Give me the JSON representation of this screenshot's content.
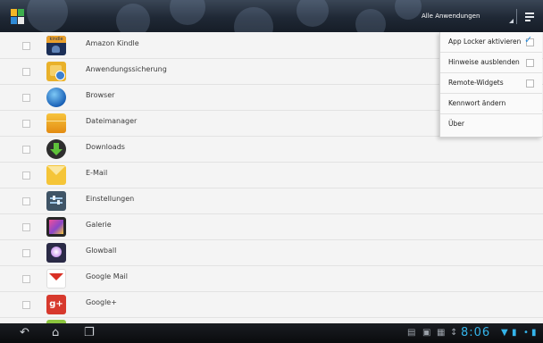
{
  "header": {
    "filter_label": "Alle Anwendungen"
  },
  "apps": [
    {
      "label": "Amazon Kindle",
      "icon": "kindle-icon",
      "icon_text": "kindle",
      "checked": false
    },
    {
      "label": "Anwendungssicherung",
      "icon": "app-backup-icon",
      "checked": false
    },
    {
      "label": "Browser",
      "icon": "browser-globe-icon",
      "checked": false
    },
    {
      "label": "Dateimanager",
      "icon": "folder-icon",
      "checked": false
    },
    {
      "label": "Downloads",
      "icon": "download-icon",
      "checked": false
    },
    {
      "label": "E-Mail",
      "icon": "email-icon",
      "checked": false
    },
    {
      "label": "Einstellungen",
      "icon": "settings-icon",
      "checked": false
    },
    {
      "label": "Galerie",
      "icon": "gallery-icon",
      "checked": false
    },
    {
      "label": "Glowball",
      "icon": "glowball-icon",
      "checked": false
    },
    {
      "label": "Google Mail",
      "icon": "gmail-icon",
      "checked": false
    },
    {
      "label": "Google+",
      "icon": "google-plus-icon",
      "icon_text": "g+",
      "checked": false
    }
  ],
  "menu": {
    "items": [
      {
        "label": "App Locker aktivieren",
        "checkbox": true,
        "checked": true
      },
      {
        "label": "Hinweise ausblenden",
        "checkbox": true,
        "checked": false
      },
      {
        "label": "Remote-Widgets",
        "checkbox": true,
        "checked": false
      },
      {
        "label": "Kennwort ändern",
        "checkbox": false
      },
      {
        "label": "Über",
        "checkbox": false
      }
    ]
  },
  "status_bar": {
    "clock": "8:06",
    "nav_icons": [
      "back-icon",
      "home-icon",
      "recent-apps-icon"
    ],
    "tray_icons": [
      "keyboard-icon",
      "lock-icon",
      "screenshot-icon",
      "usb-icon",
      "wifi-icon",
      "signal-icon",
      "battery-icon"
    ]
  },
  "colors": {
    "accent": "#34b4ea",
    "checkmark": "#2a8ad8",
    "action_bar": "#1f2835"
  }
}
